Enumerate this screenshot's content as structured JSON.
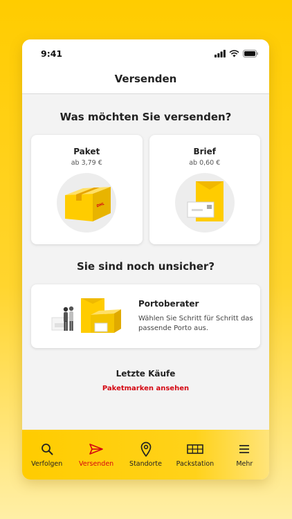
{
  "status_bar": {
    "time": "9:41"
  },
  "nav": {
    "title": "Versenden"
  },
  "send_section": {
    "heading": "Was möchten Sie versenden?",
    "options": [
      {
        "title": "Paket",
        "price": "ab 3,79 €",
        "icon": "parcel-box-icon"
      },
      {
        "title": "Brief",
        "price": "ab 0,60 €",
        "icon": "letter-envelope-icon"
      }
    ]
  },
  "unsure_section": {
    "heading": "Sie sind noch unsicher?",
    "card_title": "Portoberater",
    "card_description": "Wählen Sie Schritt für Schritt das passende Porto aus.",
    "icon": "porto-advisor-illustration"
  },
  "recent_purchases": {
    "title": "Letzte Käufe",
    "link": "Paketmarken ansehen"
  },
  "tabs": [
    {
      "label": "Verfolgen",
      "icon": "search-icon",
      "active": false
    },
    {
      "label": "Versenden",
      "icon": "send-icon",
      "active": true
    },
    {
      "label": "Standorte",
      "icon": "location-pin-icon",
      "active": false
    },
    {
      "label": "Packstation",
      "icon": "packstation-icon",
      "active": false
    },
    {
      "label": "Mehr",
      "icon": "menu-icon",
      "active": false
    }
  ],
  "colors": {
    "brand_yellow": "#FFCC00",
    "brand_red": "#D40511",
    "background": "#F3F3F3",
    "card": "#FFFFFF"
  }
}
